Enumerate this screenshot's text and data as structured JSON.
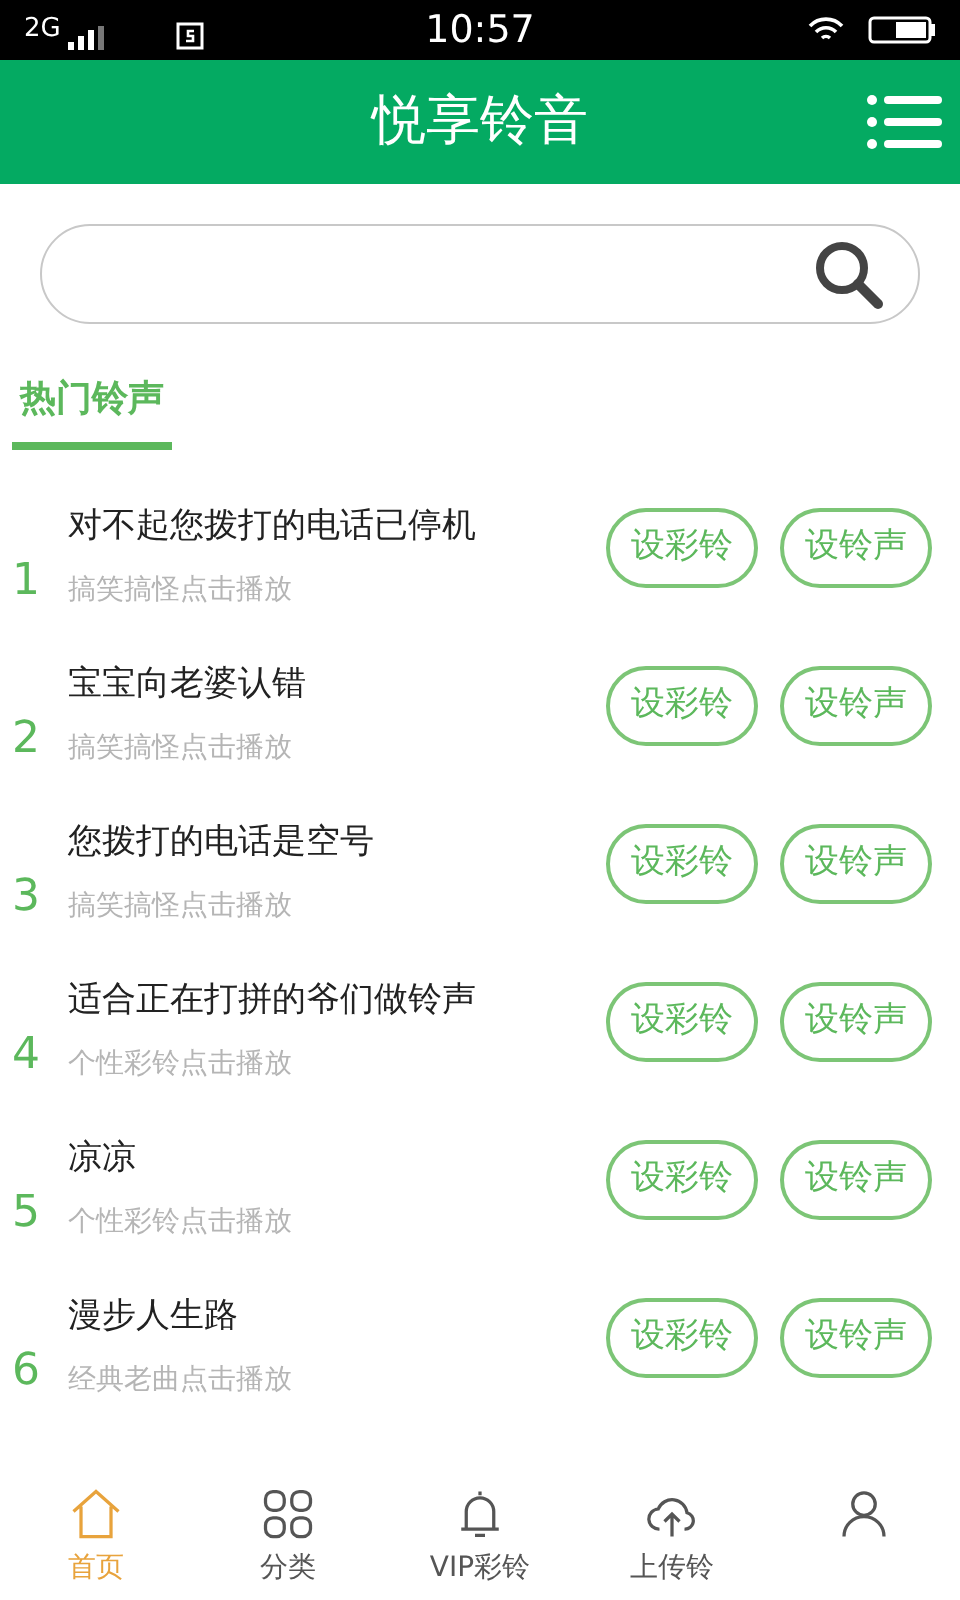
{
  "status_bar": {
    "network": "2G",
    "time": "10:57"
  },
  "header": {
    "title": "悦享铃音"
  },
  "search": {
    "kind": "rounded"
  },
  "section": {
    "title": "热门铃声",
    "selected": true
  },
  "ringtones": [
    {
      "rank": "1",
      "title": "对不起您拨打的电话已停机",
      "subtitle": "搞笑搞怪点击播放",
      "buttons": [
        "设彩铃",
        "设铃声"
      ]
    },
    {
      "rank": "2",
      "title": "宝宝向老婆认错",
      "subtitle": "搞笑搞怪点击播放",
      "buttons": [
        "设彩铃",
        "设铃声"
      ]
    },
    {
      "rank": "3",
      "title": "您拨打的电话是空号",
      "subtitle": "搞笑搞怪点击播放",
      "buttons": [
        "设彩铃",
        "设铃声"
      ]
    },
    {
      "rank": "4",
      "title": "适合正在打拼的爷们做铃声",
      "subtitle": "个性彩铃点击播放",
      "buttons": [
        "设彩铃",
        "设铃声"
      ]
    },
    {
      "rank": "5",
      "title": "凉凉",
      "subtitle": "个性彩铃点击播放",
      "buttons": [
        "设彩铃",
        "设铃声"
      ]
    },
    {
      "rank": "6",
      "title": "漫步人生路",
      "subtitle": "经典老曲点击播放",
      "buttons": [
        "设彩铃",
        "设铃声"
      ]
    }
  ],
  "bottom_nav": [
    {
      "kind": "home",
      "label": "首页",
      "selected": true
    },
    {
      "kind": "grid",
      "label": "分类",
      "selected": false
    },
    {
      "kind": "bell",
      "label": "VIP彩铃",
      "selected": false
    },
    {
      "kind": "upload",
      "label": "上传铃",
      "selected": false
    },
    {
      "kind": "user",
      "selected": false
    }
  ]
}
